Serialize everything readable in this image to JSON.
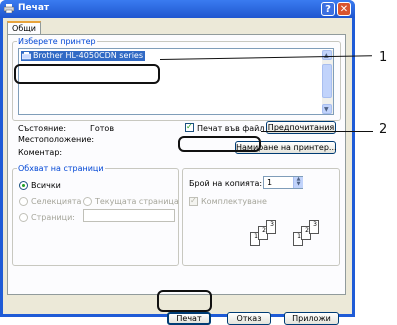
{
  "window": {
    "title": "Печат"
  },
  "tabs": [
    {
      "label": "Общи"
    }
  ],
  "select_printer": {
    "label": "Изберете принтер",
    "items": [
      {
        "name": "Brother HL-4050CDN series",
        "selected": true
      }
    ]
  },
  "status": {
    "status_label": "Състояние:",
    "status_value": "Готов",
    "location_label": "Местоположение:",
    "comment_label": "Коментар:"
  },
  "print_to_file": {
    "label": "Печат във файл",
    "checked": true
  },
  "buttons": {
    "preferences": "Предпочитания",
    "find_printer": "Намиране на принтер...",
    "print": "Печат",
    "cancel": "Отказ",
    "apply": "Приложи"
  },
  "page_range": {
    "label": "Обхват на страници",
    "all": "Всички",
    "selection": "Селекцията",
    "current_page": "Текущата страница",
    "pages": "Страници:"
  },
  "copies": {
    "label": "Брой на копията:",
    "value": "1",
    "collate": "Комплектуване"
  },
  "callouts": {
    "one": "1",
    "two": "2"
  },
  "colors": {
    "titlebar": "#1f56cf",
    "accent": "#316ac5",
    "close": "#d9552e"
  }
}
